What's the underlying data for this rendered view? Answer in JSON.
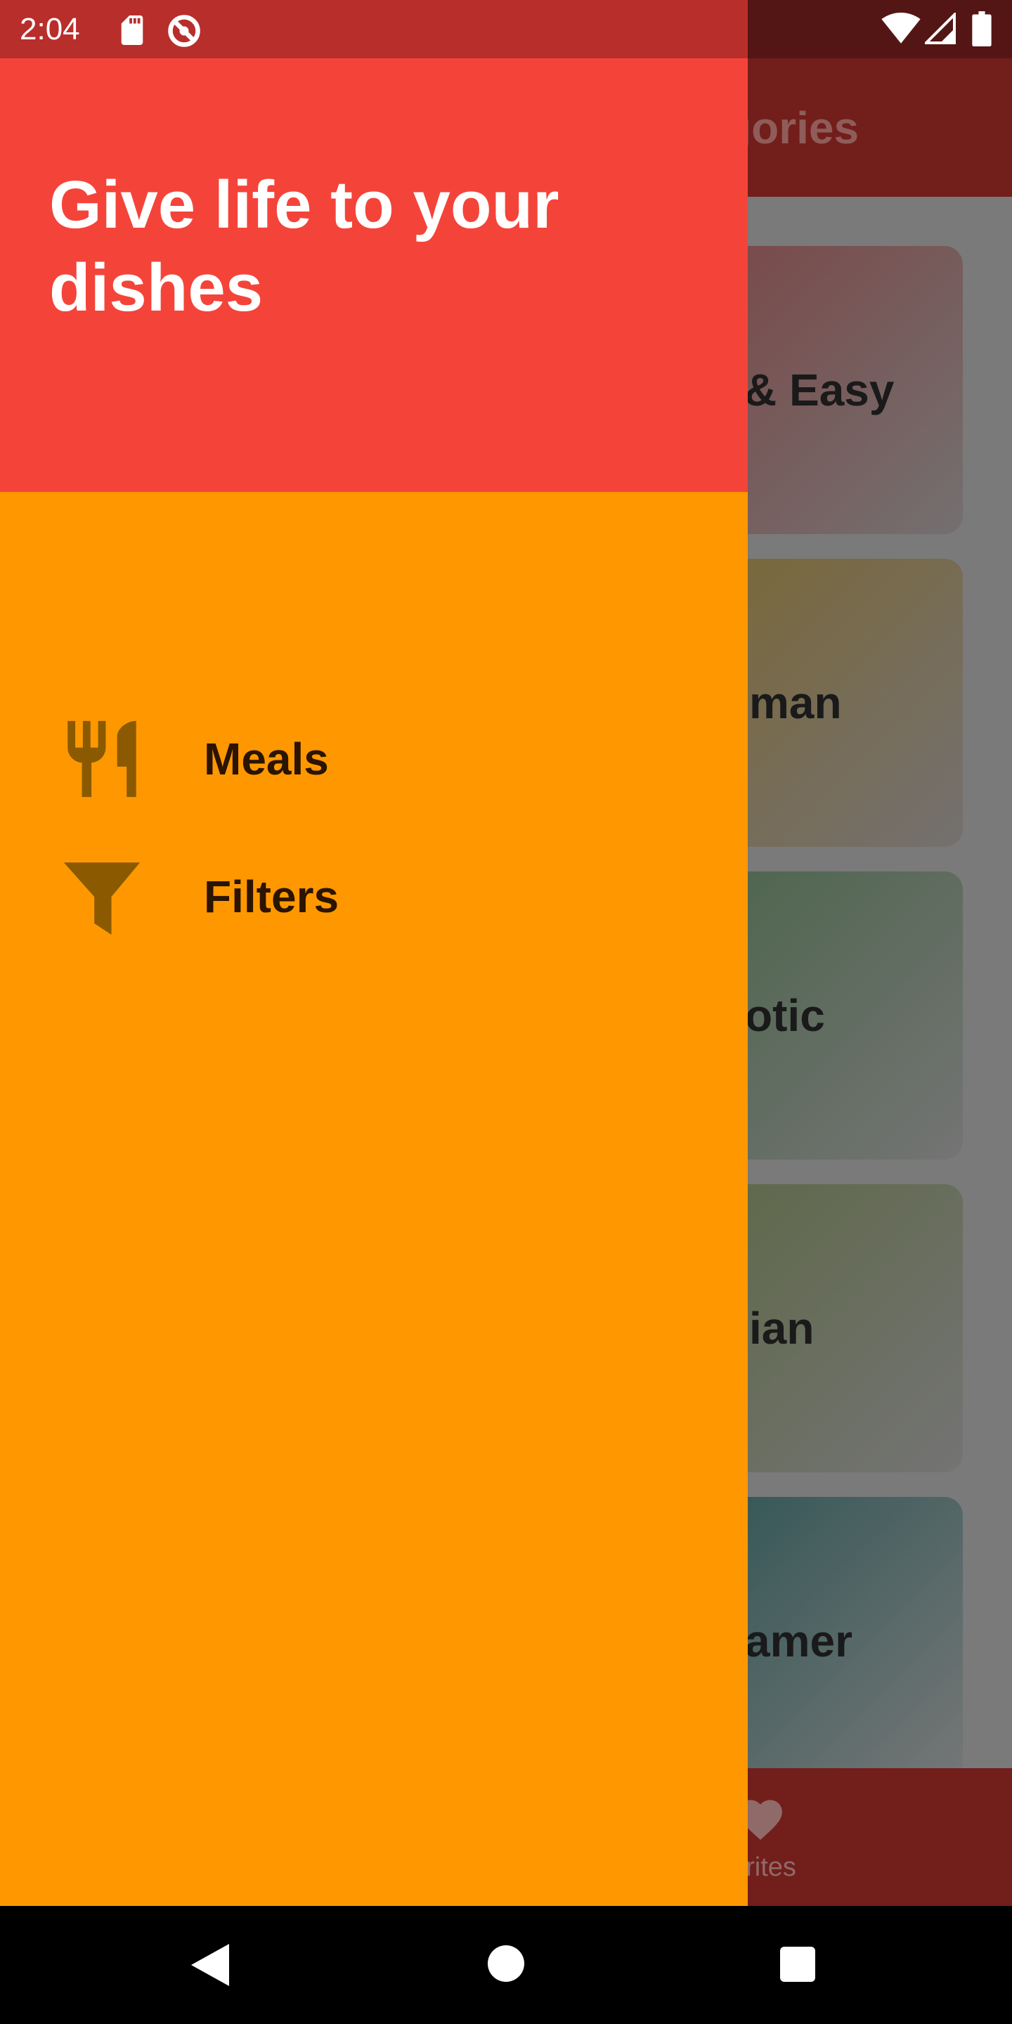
{
  "status_bar": {
    "time": "2:04",
    "icons": [
      "sd-card-icon",
      "sync-icon",
      "wifi-icon",
      "cell-signal-icon",
      "battery-icon"
    ]
  },
  "app_bar": {
    "title_visible": "gories"
  },
  "categories": [
    {
      "label_visible": "& Easy",
      "color": "#7a5050"
    },
    {
      "label_visible": "man",
      "color": "#7a6a42"
    },
    {
      "label_visible": "otic",
      "color": "#556b55"
    },
    {
      "label_visible": "ian",
      "color": "#666b52"
    },
    {
      "label_visible": "amer",
      "color": "#3f5f5f"
    }
  ],
  "bottom_nav": {
    "label_visible": "orites",
    "icon": "heart-icon"
  },
  "drawer": {
    "header_title": "Give life to your dishes",
    "items": [
      {
        "label": "Meals",
        "icon": "restaurant-icon"
      },
      {
        "label": "Filters",
        "icon": "filter-icon"
      }
    ]
  },
  "nav_bar": {
    "icons": [
      "back-icon",
      "home-icon",
      "recents-icon"
    ]
  },
  "colors": {
    "drawer_header": "#f4443a",
    "drawer_body": "#ff9800",
    "status_bar_drawer": "#b82e2b",
    "app_bar_dimmed": "#721e1b",
    "drawer_icon": "#8b5a00"
  }
}
